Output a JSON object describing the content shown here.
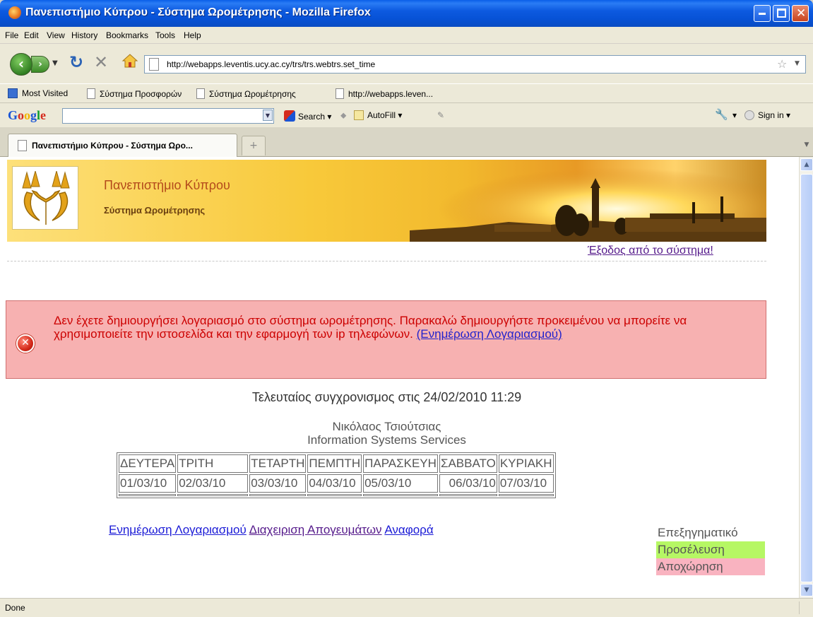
{
  "window": {
    "title": "Πανεπιστήμιο Κύπρου - Σύστημα Ωρομέτρησης - Mozilla Firefox"
  },
  "menu": [
    "File",
    "Edit",
    "View",
    "History",
    "Bookmarks",
    "Tools",
    "Help"
  ],
  "nav": {
    "url": "http://webapps.leventis.ucy.ac.cy/trs/trs.webtrs.set_time"
  },
  "bookmarks": [
    "Most Visited",
    "Σύστημα Προσφορών",
    "Σύστημα Ωρομέτρησης",
    "http://webapps.leven..."
  ],
  "google": {
    "logo": "Google",
    "search_label": "Search",
    "autofill_label": "AutoFill",
    "signin_label": "Sign in"
  },
  "tab": {
    "label": "Πανεπιστήμιο Κύπρου - Σύστημα Ωρο...",
    "new_tab": "+"
  },
  "page": {
    "university": "Πανεπιστήμιο Κύπρου",
    "system": "Σύστημα Ωρομέτρησης",
    "logout": "Έξοδος από το σύστημα!",
    "error": {
      "message": "Δεν έχετε δημιουργήσει λογαριασμό στο σύστημα ωρομέτρησης. Παρακαλώ δημιουργήστε προκειμένου να μπορείτε να χρησιμοποιείτε την ιστοσελίδα και την εφαρμογή των ip τηλεφώνων.",
      "link": "(Ενημέρωση Λογαριασμού)"
    },
    "sync": "Τελευταίος συγχρονισμος στις 24/02/2010 11:29",
    "person": {
      "name": "Νικόλαος Τσιούτσιας",
      "department": "Information Systems Services"
    },
    "days": [
      "ΔΕΥΤΕΡΑ",
      "ΤΡΙΤΗ",
      "ΤΕΤΑΡΤΗ",
      "ΠΕΜΠΤΗ",
      "ΠΑΡΑΣΚΕΥΗ",
      "ΣΑΒΒΑΤΟ",
      "ΚΥΡΙΑΚΗ"
    ],
    "dates": [
      "01/03/10",
      "02/03/10",
      "03/03/10",
      "04/03/10",
      "05/03/10",
      "06/03/10",
      "07/03/10"
    ],
    "links": {
      "account": "Ενημέρωση Λογαριασμού",
      "afternoons": "Διαχειριση Απογευμάτων",
      "report": "Αναφορά"
    },
    "legend": {
      "title": "Επεξηγηματικό",
      "arrival": "Προσέλευση",
      "departure": "Αποχώρηση"
    }
  },
  "status": {
    "text": "Done"
  },
  "colors": {
    "arrival": "#b6f764",
    "departure": "#f9b3c0",
    "error_bg": "#f7b1b1",
    "error_text": "#cc0000"
  }
}
